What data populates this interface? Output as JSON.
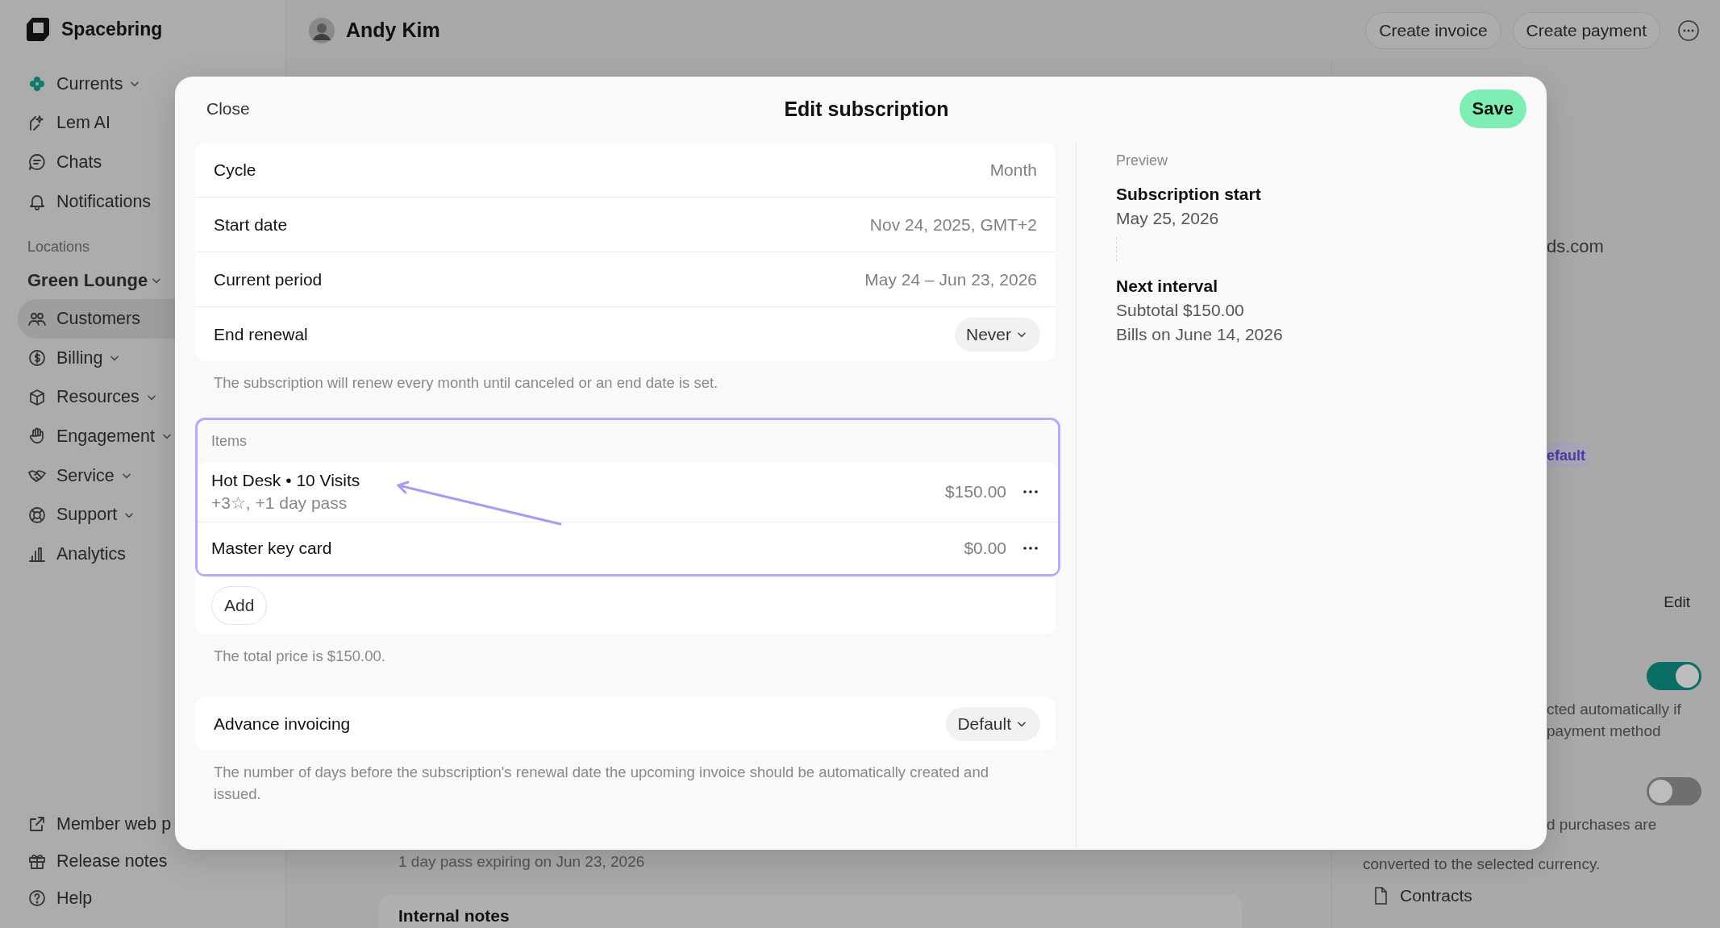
{
  "sidebar": {
    "brand": "Spacebring",
    "top_items": [
      {
        "label": "Currents",
        "expandable": true,
        "selected": false
      },
      {
        "label": "Lem AI",
        "expandable": false,
        "selected": false
      },
      {
        "label": "Chats",
        "expandable": false,
        "selected": false
      },
      {
        "label": "Notifications",
        "expandable": false,
        "selected": false
      }
    ],
    "section_label": "Locations",
    "location": {
      "label": "Green Lounge",
      "expandable": true
    },
    "nav_items": [
      {
        "label": "Customers",
        "expandable": false,
        "selected": true
      },
      {
        "label": "Billing",
        "expandable": true,
        "selected": false
      },
      {
        "label": "Resources",
        "expandable": true,
        "selected": false
      },
      {
        "label": "Engagement",
        "expandable": true,
        "selected": false
      },
      {
        "label": "Service",
        "expandable": true,
        "selected": false
      },
      {
        "label": "Support",
        "expandable": true,
        "selected": false
      },
      {
        "label": "Analytics",
        "expandable": false,
        "selected": false
      }
    ],
    "footer_items": [
      {
        "label": "Member web p"
      },
      {
        "label": "Release notes"
      },
      {
        "label": "Help"
      }
    ]
  },
  "header": {
    "customer_name": "Andy Kim",
    "actions": [
      "Create invoice",
      "Create payment"
    ]
  },
  "background_main": {
    "pass_note": "1 day pass expiring on Jun 23, 2026",
    "internal_notes": "Internal notes"
  },
  "background_right": {
    "email_fragment": "ds.com",
    "badge": "efault",
    "edit": "Edit",
    "toggles": [
      {
        "on": true,
        "lines": [
          "cted automatically if",
          "payment method"
        ]
      },
      {
        "on": false,
        "lines": [
          "d purchases are",
          "converted to the selected currency."
        ]
      }
    ],
    "contracts": "Contracts"
  },
  "modal": {
    "close": "Close",
    "title": "Edit subscription",
    "save": "Save",
    "fields": [
      {
        "label": "Cycle",
        "value": "Month",
        "kind": "text"
      },
      {
        "label": "Start date",
        "value": "Nov 24, 2025, GMT+2",
        "kind": "text"
      },
      {
        "label": "Current period",
        "value": "May 24 – Jun 23, 2026",
        "kind": "text"
      },
      {
        "label": "End renewal",
        "value": "Never",
        "kind": "dropdown"
      }
    ],
    "fields_hint": "The subscription will renew every month until canceled or an end date is set.",
    "items": {
      "label": "Items",
      "selected": true,
      "rows": [
        {
          "name": "Hot Desk • 10 Visits",
          "detail": "+3☆, +1 day pass",
          "price": "$150.00"
        },
        {
          "name": "Master key card",
          "price": "$0.00"
        }
      ],
      "add": "Add"
    },
    "total_hint": "The total price is $150.00.",
    "advance": {
      "label": "Advance invoicing",
      "value": "Default",
      "kind": "dropdown"
    },
    "advance_hint": "The number of days before the subscription's renewal date the upcoming invoice should be automatically created and issued.",
    "preview": {
      "label": "Preview",
      "events": [
        {
          "title": "Subscription start",
          "lines": [
            "May 25, 2026"
          ]
        },
        {
          "title": "Next interval",
          "lines": [
            "Subtotal $150.00",
            "Bills on June 14, 2026"
          ]
        }
      ]
    }
  }
}
